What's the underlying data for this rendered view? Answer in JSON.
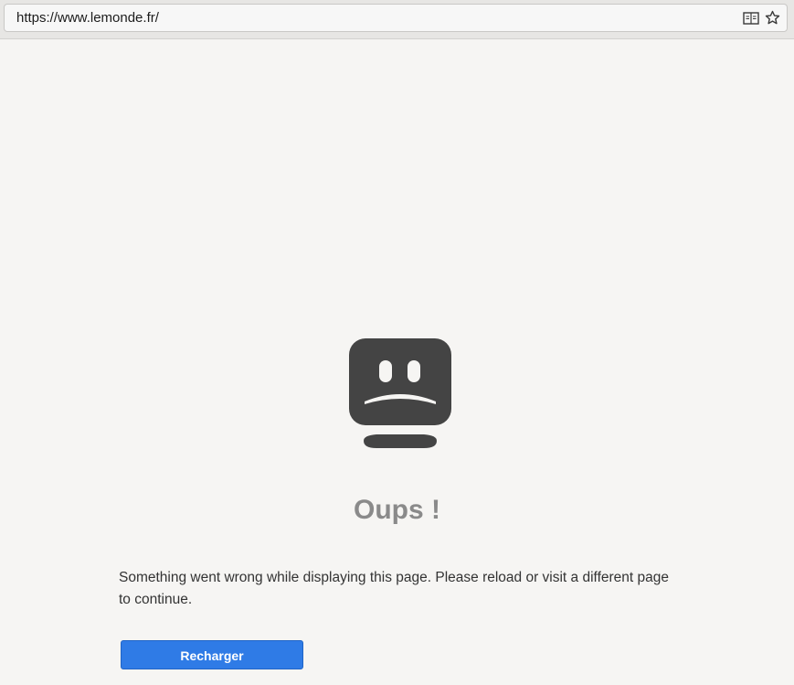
{
  "browser": {
    "url": "https://www.lemonde.fr/",
    "icons": {
      "reader": "reader-view-icon",
      "bookmark": "star-icon"
    }
  },
  "error_page": {
    "icon": "sad-face-icon",
    "title": "Oups !",
    "message": "Something went wrong while displaying this page. Please reload or visit a different page to continue.",
    "reload_label": "Recharger"
  },
  "colors": {
    "background": "#f6f5f3",
    "icon": "#444444",
    "title": "#8a8a8a",
    "button": "#2f7be6"
  }
}
